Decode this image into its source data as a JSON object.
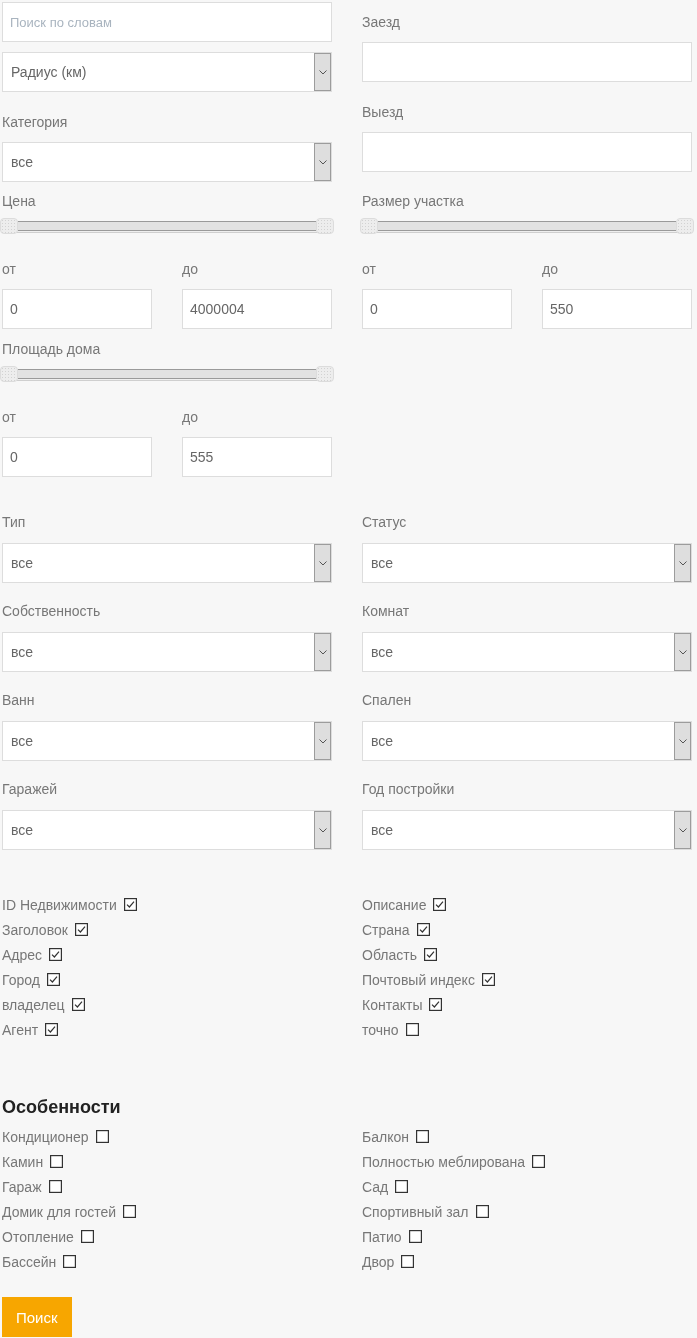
{
  "keyword_search": {
    "placeholder": "Поиск по словам"
  },
  "radius_select": {
    "value": "Радиус (км)"
  },
  "category": {
    "label": "Категория",
    "value": "все"
  },
  "check_in": {
    "label": "Заезд"
  },
  "check_out": {
    "label": "Выезд"
  },
  "ranges": [
    {
      "label": "Цена",
      "handles": [
        {
          "level": 0
        },
        {
          "level": 1
        }
      ],
      "from": {
        "label": "от",
        "value": "0"
      },
      "to": {
        "label": "до",
        "value": "4000004"
      }
    },
    {
      "label": "Размер участка",
      "handles": [
        {
          "level": 0
        },
        {
          "level": 1
        }
      ],
      "from": {
        "label": "от",
        "value": "0"
      },
      "to": {
        "label": "до",
        "value": "550"
      }
    },
    {
      "label": "Площадь дома",
      "handles": [
        {
          "level": 0
        },
        {
          "level": 1
        }
      ],
      "from": {
        "label": "от",
        "value": "0"
      },
      "to": {
        "label": "до",
        "value": "555"
      }
    }
  ],
  "filters": [
    {
      "label": "Тип",
      "value": "все"
    },
    {
      "label": "Статус",
      "value": "все"
    },
    {
      "label": "Собственность",
      "value": "все"
    },
    {
      "label": "Комнат",
      "value": "все"
    },
    {
      "label": "Ванн",
      "value": "все"
    },
    {
      "label": "Спален",
      "value": "все"
    },
    {
      "label": "Гаражей",
      "value": "все"
    },
    {
      "label": "Год постройки",
      "value": "все"
    }
  ],
  "search_in": [
    {
      "label": "ID Недвижимости",
      "checked": true
    },
    {
      "label": "Описание",
      "checked": true
    },
    {
      "label": "Заголовок",
      "checked": true
    },
    {
      "label": "Страна",
      "checked": true
    },
    {
      "label": "Адрес",
      "checked": true
    },
    {
      "label": "Область",
      "checked": true
    },
    {
      "label": "Город",
      "checked": true
    },
    {
      "label": "Почтовый индекс",
      "checked": true
    },
    {
      "label": "владелец",
      "checked": true
    },
    {
      "label": "Контакты",
      "checked": true
    },
    {
      "label": "Агент",
      "checked": true
    },
    {
      "label": "точно",
      "checked": false
    }
  ],
  "features": {
    "title": "Особенности",
    "items": [
      {
        "label": "Кондиционер",
        "checked": false
      },
      {
        "label": "Балкон",
        "checked": false
      },
      {
        "label": "Камин",
        "checked": false
      },
      {
        "label": "Полностью меблирована",
        "checked": false
      },
      {
        "label": "Гараж",
        "checked": false
      },
      {
        "label": "Сад",
        "checked": false
      },
      {
        "label": "Домик для гостей",
        "checked": false
      },
      {
        "label": "Спортивный зал",
        "checked": false
      },
      {
        "label": "Отопление",
        "checked": false
      },
      {
        "label": "Патио",
        "checked": false
      },
      {
        "label": "Бассейн",
        "checked": false
      },
      {
        "label": "Двор",
        "checked": false
      }
    ]
  },
  "submit_button": "Поиск"
}
